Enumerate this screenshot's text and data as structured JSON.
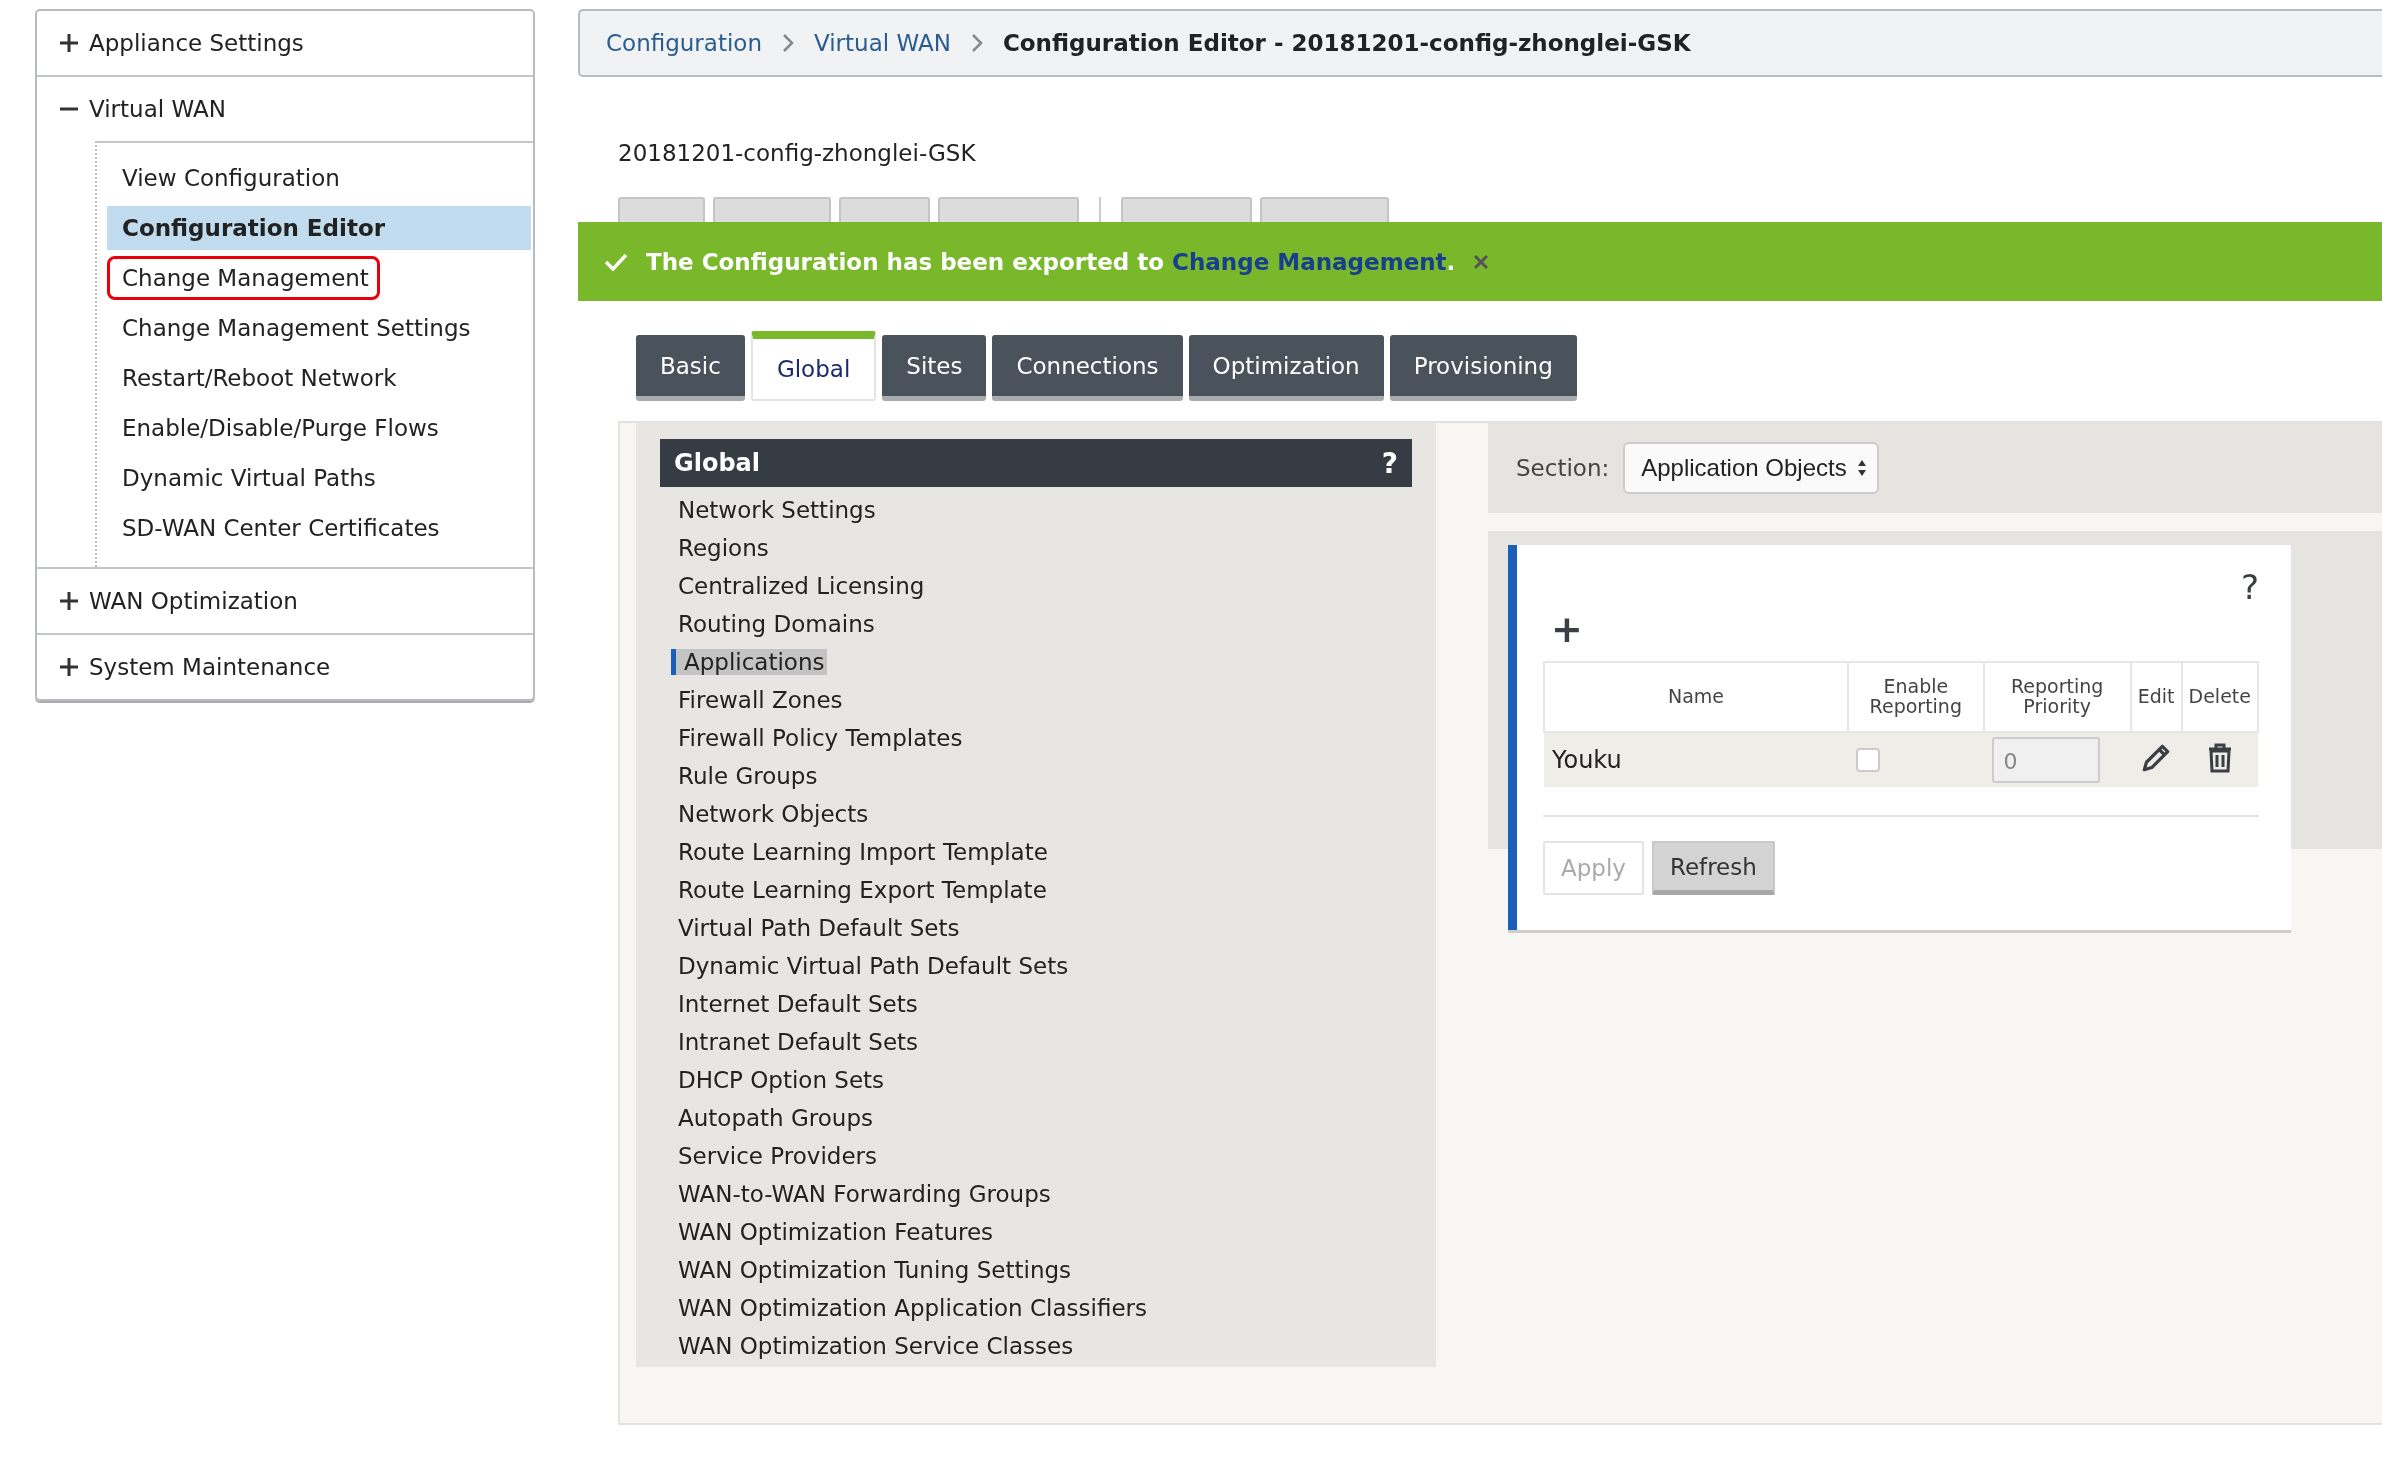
{
  "sidebar": {
    "sections": [
      {
        "label": "Appliance Settings",
        "expanded": false
      },
      {
        "label": "Virtual WAN",
        "expanded": true,
        "children": [
          {
            "label": "View Configuration",
            "selected": false,
            "annotated": false
          },
          {
            "label": "Configuration Editor",
            "selected": true,
            "annotated": false
          },
          {
            "label": "Change Management",
            "selected": false,
            "annotated": true
          },
          {
            "label": "Change Management Settings",
            "selected": false,
            "annotated": false
          },
          {
            "label": "Restart/Reboot Network",
            "selected": false,
            "annotated": false
          },
          {
            "label": "Enable/Disable/Purge Flows",
            "selected": false,
            "annotated": false
          },
          {
            "label": "Dynamic Virtual Paths",
            "selected": false,
            "annotated": false
          },
          {
            "label": "SD-WAN Center Certificates",
            "selected": false,
            "annotated": false
          }
        ]
      },
      {
        "label": "WAN Optimization",
        "expanded": false
      },
      {
        "label": "System Maintenance",
        "expanded": false
      }
    ]
  },
  "breadcrumb": [
    {
      "label": "Configuration",
      "kind": "link"
    },
    {
      "label": "Virtual WAN",
      "kind": "link"
    },
    {
      "label": "Configuration Editor - 20181201-config-zhonglei-GSK",
      "kind": "current"
    }
  ],
  "file_name": "20181201-config-zhonglei-GSK",
  "banner": {
    "text": "The Configuration has been exported to",
    "link": "Change Management",
    "after": "."
  },
  "tabs": [
    {
      "label": "Basic",
      "selected": false
    },
    {
      "label": "Global",
      "selected": true
    },
    {
      "label": "Sites",
      "selected": false
    },
    {
      "label": "Connections",
      "selected": false
    },
    {
      "label": "Optimization",
      "selected": false
    },
    {
      "label": "Provisioning",
      "selected": false
    }
  ],
  "global_panel": {
    "title": "Global",
    "help": "?",
    "items": [
      {
        "label": "Network Settings",
        "selected": false
      },
      {
        "label": "Regions",
        "selected": false
      },
      {
        "label": "Centralized Licensing",
        "selected": false
      },
      {
        "label": "Routing Domains",
        "selected": false
      },
      {
        "label": "Applications",
        "selected": true
      },
      {
        "label": "Firewall Zones",
        "selected": false
      },
      {
        "label": "Firewall Policy Templates",
        "selected": false
      },
      {
        "label": "Rule Groups",
        "selected": false
      },
      {
        "label": "Network Objects",
        "selected": false
      },
      {
        "label": "Route Learning Import Template",
        "selected": false
      },
      {
        "label": "Route Learning Export Template",
        "selected": false
      },
      {
        "label": "Virtual Path Default Sets",
        "selected": false
      },
      {
        "label": "Dynamic Virtual Path Default Sets",
        "selected": false
      },
      {
        "label": "Internet Default Sets",
        "selected": false
      },
      {
        "label": "Intranet Default Sets",
        "selected": false
      },
      {
        "label": "DHCP Option Sets",
        "selected": false
      },
      {
        "label": "Autopath Groups",
        "selected": false
      },
      {
        "label": "Service Providers",
        "selected": false
      },
      {
        "label": "WAN-to-WAN Forwarding Groups",
        "selected": false
      },
      {
        "label": "WAN Optimization Features",
        "selected": false
      },
      {
        "label": "WAN Optimization Tuning Settings",
        "selected": false
      },
      {
        "label": "WAN Optimization Application Classifiers",
        "selected": false
      },
      {
        "label": "WAN Optimization Service Classes",
        "selected": false
      }
    ]
  },
  "section": {
    "label": "Section:",
    "value": "Application Objects"
  },
  "app_card": {
    "help": "?",
    "add": "+",
    "columns": [
      "Name",
      "Enable Reporting",
      "Reporting Priority",
      "Edit",
      "Delete"
    ],
    "rows": [
      {
        "name": "Youku",
        "enable_reporting": false,
        "priority": "0"
      }
    ],
    "buttons": [
      {
        "label": "Apply",
        "disabled": true
      },
      {
        "label": "Refresh",
        "disabled": false
      }
    ]
  }
}
